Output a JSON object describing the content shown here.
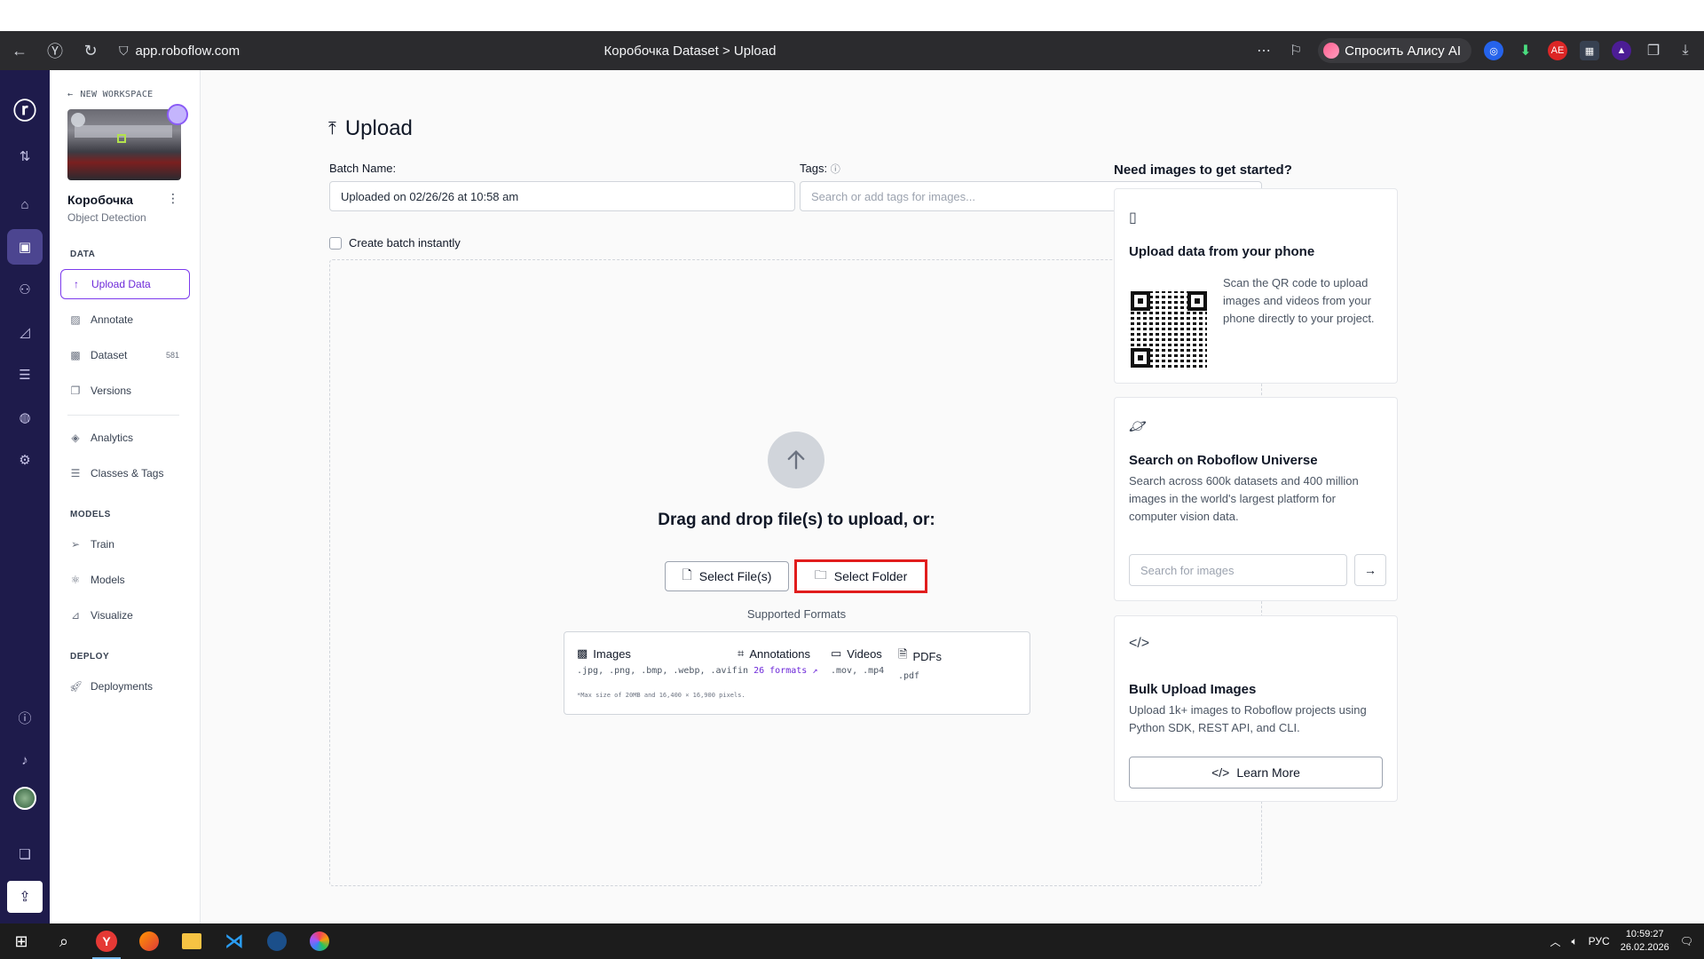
{
  "browser": {
    "url": "app.roboflow.com",
    "page_title": "Коробочка Dataset > Upload",
    "alice_label": "Спросить Алису AI"
  },
  "sidebar": {
    "back_label": "NEW WORKSPACE",
    "project_name": "Коробочка",
    "project_type": "Object Detection",
    "sections": {
      "data": "DATA",
      "models": "MODELS",
      "deploy": "DEPLOY"
    },
    "items": {
      "upload_data": "Upload Data",
      "annotate": "Annotate",
      "dataset": "Dataset",
      "dataset_count": "581",
      "versions": "Versions",
      "analytics": "Analytics",
      "classes_tags": "Classes & Tags",
      "train": "Train",
      "models": "Models",
      "visualize": "Visualize",
      "deployments": "Deployments"
    }
  },
  "main": {
    "title": "Upload",
    "batch_label": "Batch Name:",
    "batch_value": "Uploaded on 02/26/26 at 10:58 am",
    "tags_label": "Tags:",
    "tags_placeholder": "Search or add tags for images...",
    "create_batch_label": "Create batch instantly",
    "drop_text": "Drag and drop file(s) to upload, or:",
    "select_files": "Select File(s)",
    "select_folder": "Select Folder",
    "supported_formats": "Supported Formats",
    "formats": {
      "images_label": "Images",
      "images_ext": ".jpg, .png, .bmp, .webp, .avif",
      "annotations_label": "Annotations",
      "annotations_prefix": "in",
      "annotations_link": "26 formats",
      "videos_label": "Videos",
      "videos_ext": ".mov, .mp4",
      "pdfs_label": "PDFs",
      "pdfs_ext": ".pdf",
      "note": "*Max size of 20MB and 16,400 × 16,900 pixels."
    }
  },
  "right_panel": {
    "heading": "Need images to get started?",
    "phone": {
      "title": "Upload data from your phone",
      "desc": "Scan the QR code to upload images and videos from your phone directly to your project."
    },
    "universe": {
      "title": "Search on Roboflow Universe",
      "desc": "Search across 600k datasets and 400 million images in the world's largest platform for computer vision data.",
      "search_placeholder": "Search for images"
    },
    "bulk": {
      "title": "Bulk Upload Images",
      "desc": "Upload 1k+ images to Roboflow projects using Python SDK, REST API, and CLI.",
      "button": "Learn More"
    }
  },
  "taskbar": {
    "lang": "РУС",
    "time": "10:59:27",
    "date": "26.02.2026"
  }
}
